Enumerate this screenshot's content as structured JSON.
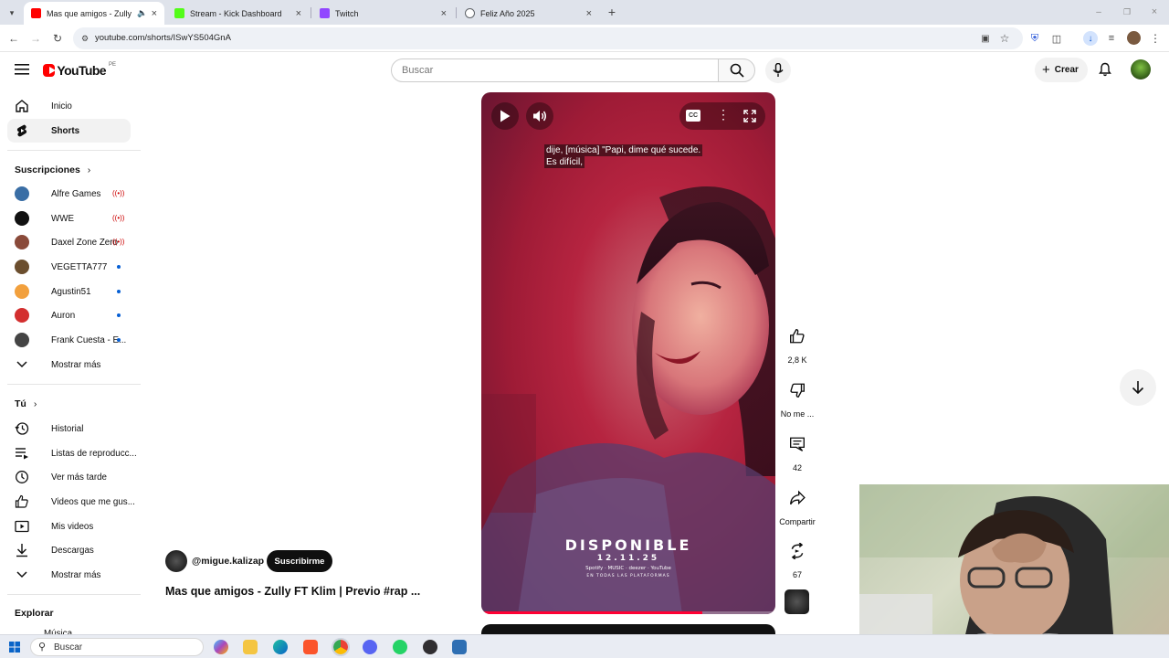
{
  "browser": {
    "tabs": [
      {
        "title": "Mas que amigos - Zully FT",
        "active": true,
        "favicon_color": "#ff0000"
      },
      {
        "title": "Stream - Kick Dashboard",
        "active": false,
        "favicon_color": "#53fc18"
      },
      {
        "title": "Twitch",
        "active": false,
        "favicon_color": "#9146ff"
      },
      {
        "title": "Feliz Año 2025",
        "active": false,
        "favicon_color": "#5f6368"
      }
    ],
    "url": "youtube.com/shorts/ISwYS504GnA"
  },
  "youtube": {
    "logo_text": "YouTube",
    "region": "PE",
    "search_placeholder": "Buscar",
    "create_label": "Crear"
  },
  "sidebar": {
    "main": [
      {
        "label": "Inicio",
        "icon": "home-icon"
      },
      {
        "label": "Shorts",
        "icon": "shorts-icon",
        "selected": true
      }
    ],
    "subscriptions_title": "Suscripciones",
    "subscriptions": [
      {
        "label": "Alfre Games",
        "status": "live",
        "color": "#3a6ea5"
      },
      {
        "label": "WWE",
        "status": "live",
        "color": "#111111"
      },
      {
        "label": "Daxel Zone Zero",
        "status": "live",
        "color": "#8a4a3a"
      },
      {
        "label": "VEGETTA777",
        "status": "new",
        "color": "#6b4e2e"
      },
      {
        "label": "Agustin51",
        "status": "new",
        "color": "#f2a03d"
      },
      {
        "label": "Auron",
        "status": "new",
        "color": "#d32f2f"
      },
      {
        "label": "Frank Cuesta - E...",
        "status": "new",
        "color": "#444444"
      }
    ],
    "show_more": "Mostrar más",
    "you_title": "Tú",
    "you_items": [
      {
        "label": "Historial",
        "icon": "history-icon"
      },
      {
        "label": "Listas de reproducc...",
        "icon": "playlists-icon"
      },
      {
        "label": "Ver más tarde",
        "icon": "watch-later-icon"
      },
      {
        "label": "Videos que me gus...",
        "icon": "liked-icon"
      },
      {
        "label": "Mis videos",
        "icon": "my-videos-icon"
      },
      {
        "label": "Descargas",
        "icon": "downloads-icon"
      },
      {
        "label": "Mostrar más",
        "icon": "chevron-down-icon"
      }
    ],
    "explore_title": "Explorar",
    "explore_partial": "Música"
  },
  "short": {
    "caption_line1": "dije, [música] \"Papi, dime qué sucede.",
    "caption_line2": "Es difícil,",
    "overlay_title": "DISPONIBLE",
    "overlay_date": "12.11.25",
    "overlay_platforms": "Spotify  ·  MUSIC  ·  deezer  ·  YouTube",
    "overlay_footer": "EN TODAS LAS PLATAFORMAS",
    "channel": "@migue.kalizap",
    "subscribe_label": "Suscribirme",
    "title": "Mas que amigos - Zully FT Klim | Previo #rap ...",
    "progress": 0.75
  },
  "actions": {
    "likes": "2,8 K",
    "dislike": "No me ...",
    "comments": "42",
    "share": "Compartir",
    "remix": "67"
  },
  "taskbar": {
    "search_label": "Buscar"
  }
}
